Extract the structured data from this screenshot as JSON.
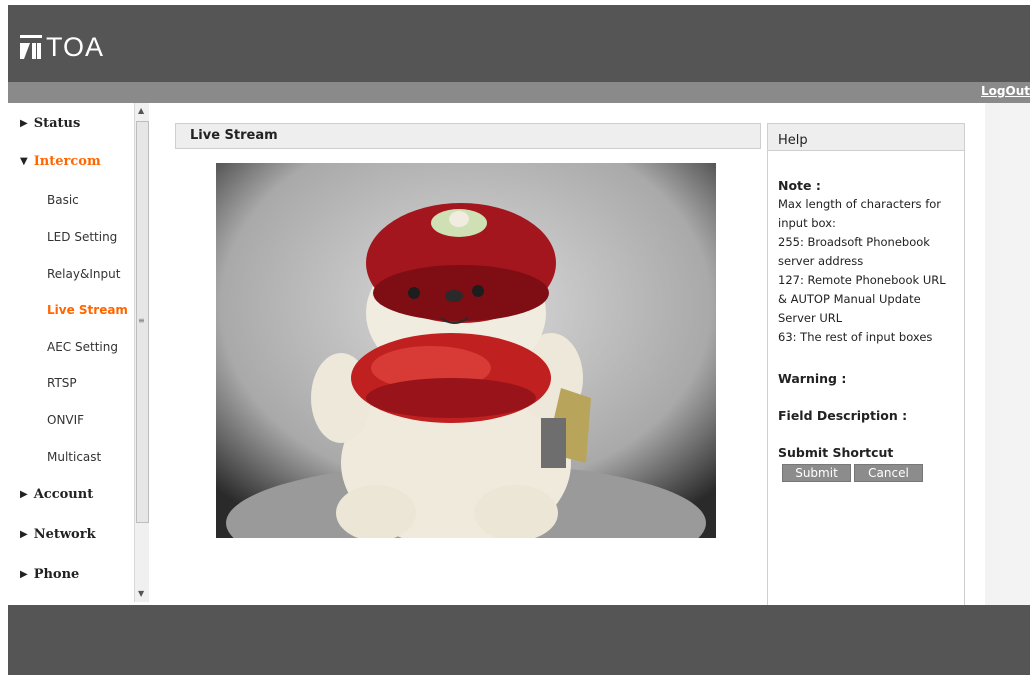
{
  "header": {
    "logo_text": "TOA",
    "logout_label": "LogOut"
  },
  "sidebar": {
    "sections": [
      {
        "label": "Status",
        "expanded": false
      },
      {
        "label": "Intercom",
        "expanded": true,
        "active": true
      },
      {
        "label": "Account",
        "expanded": false
      },
      {
        "label": "Network",
        "expanded": false
      },
      {
        "label": "Phone",
        "expanded": false
      }
    ],
    "intercom_items": [
      {
        "label": "Basic"
      },
      {
        "label": "LED Setting"
      },
      {
        "label": "Relay&Input"
      },
      {
        "label": "Live Stream",
        "active": true
      },
      {
        "label": "AEC Setting"
      },
      {
        "label": "RTSP"
      },
      {
        "label": "ONVIF"
      },
      {
        "label": "Multicast"
      }
    ]
  },
  "main": {
    "section_title": "Live Stream"
  },
  "help": {
    "title": "Help",
    "note_heading": "Note :",
    "note_lines": [
      "Max length of characters for",
      "input box:",
      "255: Broadsoft Phonebook",
      "server address",
      "127: Remote Phonebook URL",
      "& AUTOP Manual Update",
      "Server URL",
      "63: The rest of input boxes"
    ],
    "warning_heading": "Warning :",
    "field_heading": "Field Description :",
    "shortcut_heading": "Submit Shortcut",
    "submit_label": "Submit",
    "cancel_label": "Cancel"
  },
  "colors": {
    "header_bg": "#555555",
    "subbar_bg": "#8a8a8a",
    "active_nav": "#ff6600",
    "button_bg": "#8c8c8c"
  }
}
